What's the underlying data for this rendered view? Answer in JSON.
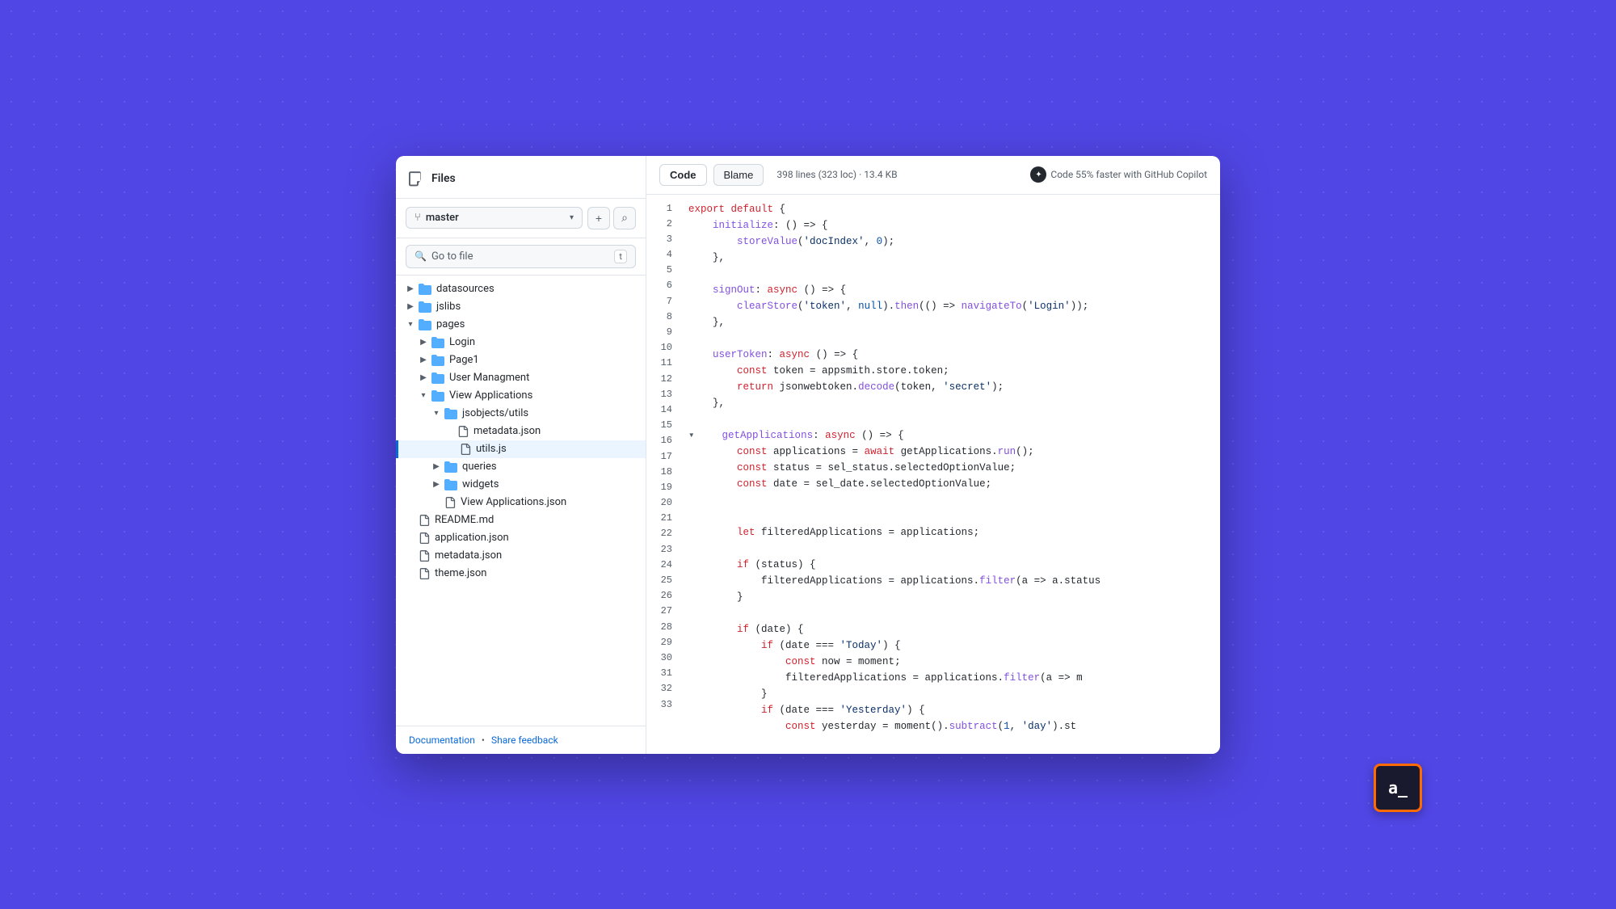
{
  "sidebar": {
    "title": "Files",
    "branch": "master",
    "search_placeholder": "Go to file",
    "search_shortcut": "t",
    "footer": {
      "doc_link": "Documentation",
      "feedback_link": "Share feedback",
      "separator": "•"
    },
    "tree": [
      {
        "id": "datasources",
        "label": "datasources",
        "type": "folder",
        "depth": 0,
        "expanded": false
      },
      {
        "id": "jslibs",
        "label": "jslibs",
        "type": "folder",
        "depth": 0,
        "expanded": false
      },
      {
        "id": "pages",
        "label": "pages",
        "type": "folder",
        "depth": 0,
        "expanded": true
      },
      {
        "id": "Login",
        "label": "Login",
        "type": "folder",
        "depth": 1,
        "expanded": false
      },
      {
        "id": "Page1",
        "label": "Page1",
        "type": "folder",
        "depth": 1,
        "expanded": false
      },
      {
        "id": "UserManagment",
        "label": "User Managment",
        "type": "folder",
        "depth": 1,
        "expanded": false
      },
      {
        "id": "ViewApplications",
        "label": "View Applications",
        "type": "folder",
        "depth": 1,
        "expanded": true
      },
      {
        "id": "jsobjectsutils",
        "label": "jsobjects/utils",
        "type": "folder",
        "depth": 2,
        "expanded": true
      },
      {
        "id": "metadatajson1",
        "label": "metadata.json",
        "type": "file",
        "depth": 3
      },
      {
        "id": "utilsjs",
        "label": "utils.js",
        "type": "file",
        "depth": 3,
        "active": true
      },
      {
        "id": "queries",
        "label": "queries",
        "type": "folder",
        "depth": 2,
        "expanded": false
      },
      {
        "id": "widgets",
        "label": "widgets",
        "type": "folder",
        "depth": 2,
        "expanded": false
      },
      {
        "id": "ViewApplicationsjson",
        "label": "View Applications.json",
        "type": "file",
        "depth": 2
      },
      {
        "id": "READMEmd",
        "label": "README.md",
        "type": "file",
        "depth": 0
      },
      {
        "id": "applicationjson",
        "label": "application.json",
        "type": "file",
        "depth": 0
      },
      {
        "id": "metadatajson2",
        "label": "metadata.json",
        "type": "file",
        "depth": 0
      },
      {
        "id": "themejson",
        "label": "theme.json",
        "type": "file",
        "depth": 0
      }
    ]
  },
  "code_panel": {
    "tabs": [
      {
        "id": "code",
        "label": "Code",
        "active": true
      },
      {
        "id": "blame",
        "label": "Blame",
        "active": false
      }
    ],
    "file_meta": "398 lines (323 loc) · 13.4 KB",
    "copilot_text": "Code 55% faster with GitHub Copilot",
    "lines": [
      {
        "num": 1,
        "content": "export default {"
      },
      {
        "num": 2,
        "content": "    initialize: () => {"
      },
      {
        "num": 3,
        "content": "        storeValue('docIndex', 0);"
      },
      {
        "num": 4,
        "content": "    },"
      },
      {
        "num": 5,
        "content": ""
      },
      {
        "num": 6,
        "content": "    signOut: async () => {"
      },
      {
        "num": 7,
        "content": "        clearStore('token', null).then(() => navigateTo('Login'));"
      },
      {
        "num": 8,
        "content": "    },"
      },
      {
        "num": 9,
        "content": ""
      },
      {
        "num": 10,
        "content": "    userToken: async () => {"
      },
      {
        "num": 11,
        "content": "        const token = appsmith.store.token;"
      },
      {
        "num": 12,
        "content": "        return jsonwebtoken.decode(token, 'secret');"
      },
      {
        "num": 13,
        "content": "    },"
      },
      {
        "num": 14,
        "content": ""
      },
      {
        "num": 15,
        "content": "    getApplications: async () => {",
        "collapsible": true
      },
      {
        "num": 16,
        "content": "        const applications = await getApplications.run();"
      },
      {
        "num": 17,
        "content": "        const status = sel_status.selectedOptionValue;"
      },
      {
        "num": 18,
        "content": "        const date = sel_date.selectedOptionValue;"
      },
      {
        "num": 19,
        "content": ""
      },
      {
        "num": 20,
        "content": ""
      },
      {
        "num": 21,
        "content": "        let filteredApplications = applications;"
      },
      {
        "num": 22,
        "content": ""
      },
      {
        "num": 23,
        "content": "        if (status) {"
      },
      {
        "num": 24,
        "content": "            filteredApplications = applications.filter(a => a.status"
      },
      {
        "num": 25,
        "content": "        }"
      },
      {
        "num": 26,
        "content": ""
      },
      {
        "num": 27,
        "content": "        if (date) {"
      },
      {
        "num": 28,
        "content": "            if (date === 'Today') {"
      },
      {
        "num": 29,
        "content": "                const now = moment;"
      },
      {
        "num": 30,
        "content": "                filteredApplications = applications.filter(a => m"
      },
      {
        "num": 31,
        "content": "            }"
      },
      {
        "num": 32,
        "content": "            if (date === 'Yesterday') {"
      },
      {
        "num": 33,
        "content": "                const yesterday = moment().subtract(1, 'day').st"
      }
    ]
  },
  "appsmith_badge": {
    "text": "a_"
  }
}
